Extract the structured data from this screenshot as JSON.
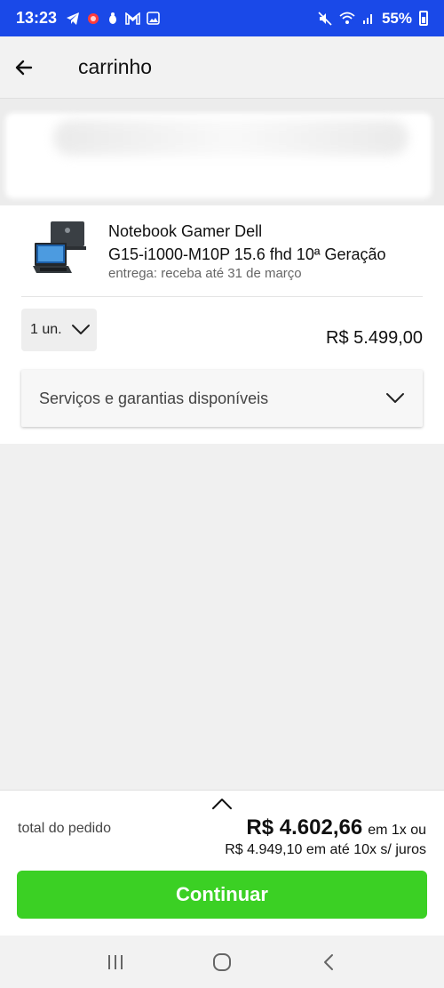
{
  "status_bar": {
    "time": "13:23",
    "battery": "55%",
    "left_icons": [
      "telegram-icon",
      "alert-icon",
      "bug-icon",
      "gmail-icon",
      "gallery-icon"
    ],
    "right_icons": [
      "mute-icon",
      "wifi-icon",
      "signal-icon"
    ]
  },
  "app_bar": {
    "title": "carrinho",
    "back_icon": "arrow-left-icon"
  },
  "product": {
    "name_line1": "Notebook Gamer Dell",
    "name_line2": "G15-i1000-M10P 15.6 fhd 10ª Geração",
    "delivery": "entrega: receba até 31 de março",
    "quantity": "1 un.",
    "price": "R$ 5.499,00"
  },
  "services": {
    "label": "Serviços e garantias disponíveis"
  },
  "footer": {
    "total_label": "total do pedido",
    "total_amount": "R$ 4.602,66",
    "total_condition": "em 1x ou",
    "installments": "R$ 4.949,10 em até 10x s/ juros",
    "continue_label": "Continuar"
  },
  "colors": {
    "status_bar": "#1a49e8",
    "continue_button": "#3bd024",
    "background": "#f0f0f0"
  },
  "nav_bar": {
    "icons": [
      "recent-apps-icon",
      "home-icon",
      "back-icon"
    ]
  }
}
